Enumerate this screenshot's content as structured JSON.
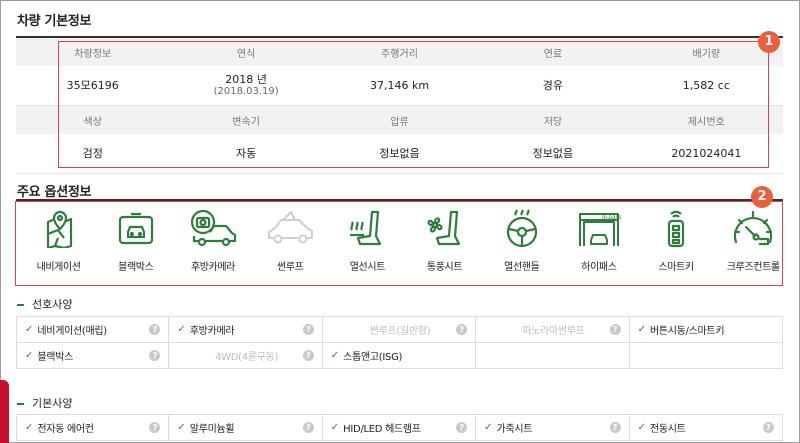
{
  "basic": {
    "title": "차량 기본정보",
    "row1_headers": [
      "차량정보",
      "연식",
      "주행거리",
      "연료",
      "배기량"
    ],
    "row1_values": [
      "35모6196",
      "2018 년",
      "37,146 km",
      "경유",
      "1,582 cc"
    ],
    "row1_sub": "(2018.03.19)",
    "row2_headers": [
      "색상",
      "변속기",
      "압류",
      "저당",
      "제시번호"
    ],
    "row2_values": [
      "검정",
      "자동",
      "정보없음",
      "정보없음",
      "2021024041"
    ],
    "badge": "1"
  },
  "options": {
    "title": "주요 옵션정보",
    "badge": "2",
    "items": [
      {
        "label": "내비게이션",
        "icon": "navigation-icon",
        "on": true
      },
      {
        "label": "블랙박스",
        "icon": "blackbox-icon",
        "on": true
      },
      {
        "label": "후방카메라",
        "icon": "rear-camera-icon",
        "on": true
      },
      {
        "label": "썬루프",
        "icon": "sunroof-icon",
        "on": false
      },
      {
        "label": "열선시트",
        "icon": "heated-seat-icon",
        "on": true
      },
      {
        "label": "통풍시트",
        "icon": "ventilated-seat-icon",
        "on": true
      },
      {
        "label": "열선핸들",
        "icon": "heated-steering-icon",
        "on": true
      },
      {
        "label": "하이패스",
        "icon": "hipass-icon",
        "on": true
      },
      {
        "label": "스마트키",
        "icon": "smartkey-icon",
        "on": true
      },
      {
        "label": "크루즈컨트롤",
        "icon": "cruise-control-icon",
        "on": true
      }
    ],
    "hipass_text": "hi-pass"
  },
  "preferred": {
    "title": "선호사양",
    "rows": [
      [
        {
          "text": "네비게이션(매립)",
          "on": true
        },
        {
          "text": "후방카메라",
          "on": true
        },
        {
          "text": "썬루프(일반형)",
          "on": false
        },
        {
          "text": "파노라마썬루프",
          "on": false
        },
        {
          "text": "버튼시동/스마트키",
          "on": true
        }
      ],
      [
        {
          "text": "블랙박스",
          "on": true
        },
        {
          "text": "4WD(4륜구동)",
          "on": false
        },
        {
          "text": "스톱앤고(ISG)",
          "on": true
        },
        {
          "text": "",
          "on": null
        },
        {
          "text": "",
          "on": null
        }
      ]
    ]
  },
  "standard": {
    "title": "기본사양",
    "rows": [
      [
        {
          "text": "전자동 에어컨",
          "on": true
        },
        {
          "text": "알루미늄휠",
          "on": true
        },
        {
          "text": "HID/LED 헤드램프",
          "on": true
        },
        {
          "text": "가죽시트",
          "on": true
        },
        {
          "text": "전동시트",
          "on": true
        }
      ]
    ]
  },
  "colors": {
    "accent_green": "#2f7d3c",
    "highlight_red": "#e0424a",
    "badge_orange": "#e8613f"
  }
}
